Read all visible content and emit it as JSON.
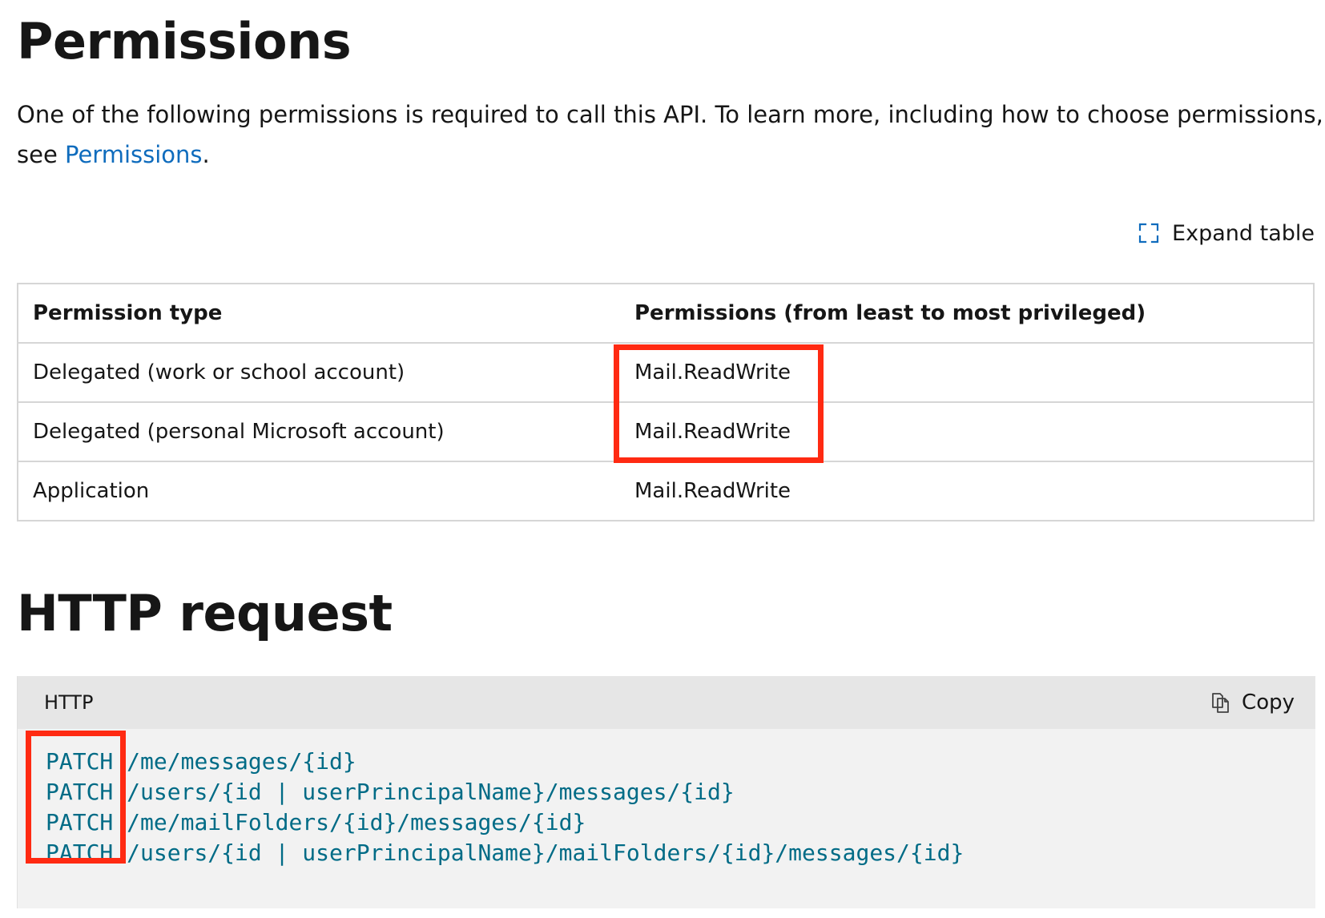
{
  "permissions_section": {
    "title": "Permissions",
    "intro_part1": "One of the following permissions is required to call this API. To learn more, including how to choose permissions,",
    "intro_see": "see ",
    "intro_link": "Permissions",
    "intro_end": ".",
    "expand_label": "Expand table",
    "table": {
      "headers": [
        "Permission type",
        "Permissions (from least to most privileged)"
      ],
      "rows": [
        {
          "type": "Delegated (work or school account)",
          "perms": "Mail.ReadWrite"
        },
        {
          "type": "Delegated (personal Microsoft account)",
          "perms": "Mail.ReadWrite"
        },
        {
          "type": "Application",
          "perms": "Mail.ReadWrite"
        }
      ]
    }
  },
  "http_section": {
    "title": "HTTP request",
    "code_lang": "HTTP",
    "copy_label": "Copy",
    "lines": [
      {
        "verb": "PATCH",
        "path": " /me/messages/{id}"
      },
      {
        "verb": "PATCH",
        "path": " /users/{id | userPrincipalName}/messages/{id}"
      },
      {
        "verb": "PATCH",
        "path": " /me/mailFolders/{id}/messages/{id}"
      },
      {
        "verb": "PATCH",
        "path": " /users/{id | userPrincipalName}/mailFolders/{id}/messages/{id}"
      }
    ]
  },
  "colors": {
    "link": "#0f6cbd",
    "highlight": "#ff2a12",
    "code_text": "#006b86"
  }
}
